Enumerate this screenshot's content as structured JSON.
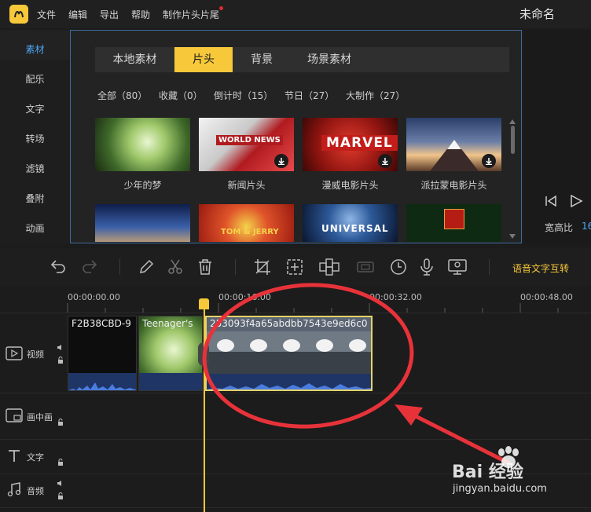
{
  "menu": {
    "file": "文件",
    "edit": "编辑",
    "export": "导出",
    "help": "帮助",
    "make_intro": "制作片头片尾"
  },
  "project_title": "未命名",
  "sidebar": {
    "items": [
      {
        "label": "素材"
      },
      {
        "label": "配乐"
      },
      {
        "label": "文字"
      },
      {
        "label": "转场"
      },
      {
        "label": "滤镜"
      },
      {
        "label": "叠附"
      },
      {
        "label": "动画"
      }
    ]
  },
  "library": {
    "tabs": [
      {
        "label": "本地素材"
      },
      {
        "label": "片头"
      },
      {
        "label": "背景"
      },
      {
        "label": "场景素材"
      }
    ],
    "filters": [
      {
        "label": "全部（80）"
      },
      {
        "label": "收藏（0）"
      },
      {
        "label": "倒计时（15）"
      },
      {
        "label": "节日（27）"
      },
      {
        "label": "大制作（27）"
      }
    ],
    "items": [
      {
        "caption": "少年的梦"
      },
      {
        "caption": "新闻片头",
        "thumb_text": "WORLD NEWS"
      },
      {
        "caption": "漫威电影片头",
        "thumb_text": "MARVEL"
      },
      {
        "caption": "派拉蒙电影片头"
      }
    ],
    "row2": [
      {
        "thumb_text": ""
      },
      {
        "thumb_text": "TOM & JERRY"
      },
      {
        "thumb_text": "UNIVERSAL"
      },
      {
        "thumb_text": ""
      }
    ]
  },
  "preview": {
    "aspect_label": "宽高比",
    "aspect_value": "16"
  },
  "toolbar": {
    "speech_text": "语音文字互转"
  },
  "ruler": {
    "t0": "00:00:00.00",
    "t1": "00:00:16.00",
    "t2": "00:00:32.00",
    "t3": "00:00:48.00"
  },
  "tracks": {
    "video": "视频",
    "pip": "画中画",
    "text": "文字",
    "audio": "音频"
  },
  "clips": [
    {
      "name": "F2B38CBD-9"
    },
    {
      "name": "Teenager's"
    },
    {
      "name": "253093f4a65abdbb7543e9ed6c0"
    }
  ],
  "watermark": {
    "brand": "Bai 经验",
    "url": "jingyan.baidu.com"
  },
  "colors": {
    "accent": "#f6c83a",
    "annotation": "#e8323a",
    "panel_border": "#3d6b9c"
  }
}
